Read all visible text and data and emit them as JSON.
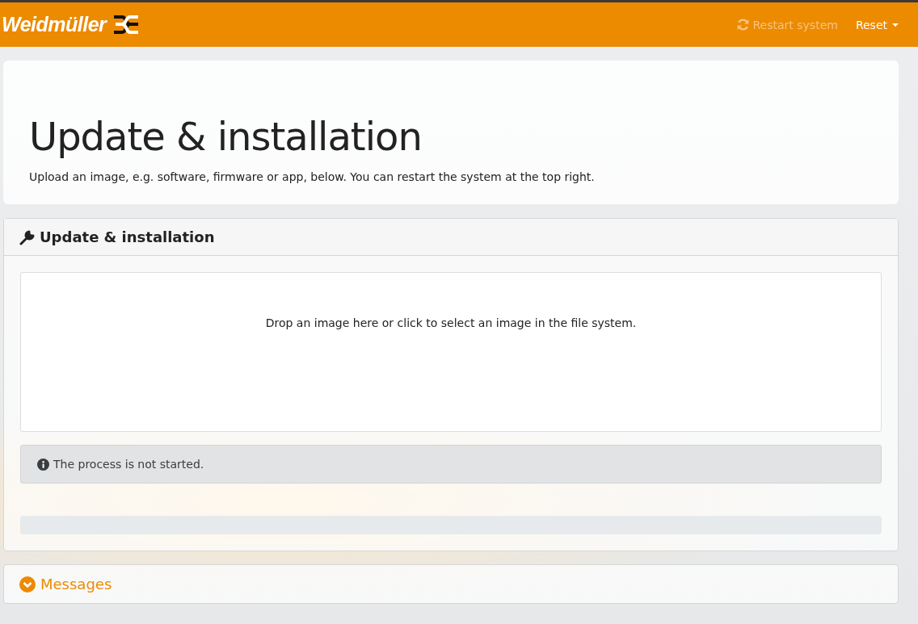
{
  "navbar": {
    "brand": "Weidmüller",
    "actions": [
      {
        "label": "Restart system",
        "kind": "restart",
        "disabled": true
      },
      {
        "label": "Reset",
        "kind": "dropdown",
        "disabled": false
      }
    ]
  },
  "header": {
    "title": "Update & installation",
    "lead": "Upload an image, e.g. software, firmware or app, below. You can restart the system at the top right."
  },
  "panel": {
    "title": "Update & installation",
    "dropzone": "Drop an image here or click to select an image in the file system.",
    "alert": "The process is not started.",
    "progress": {
      "level": 0
    }
  },
  "messages": {
    "title": "Messages",
    "expanded": false
  }
}
